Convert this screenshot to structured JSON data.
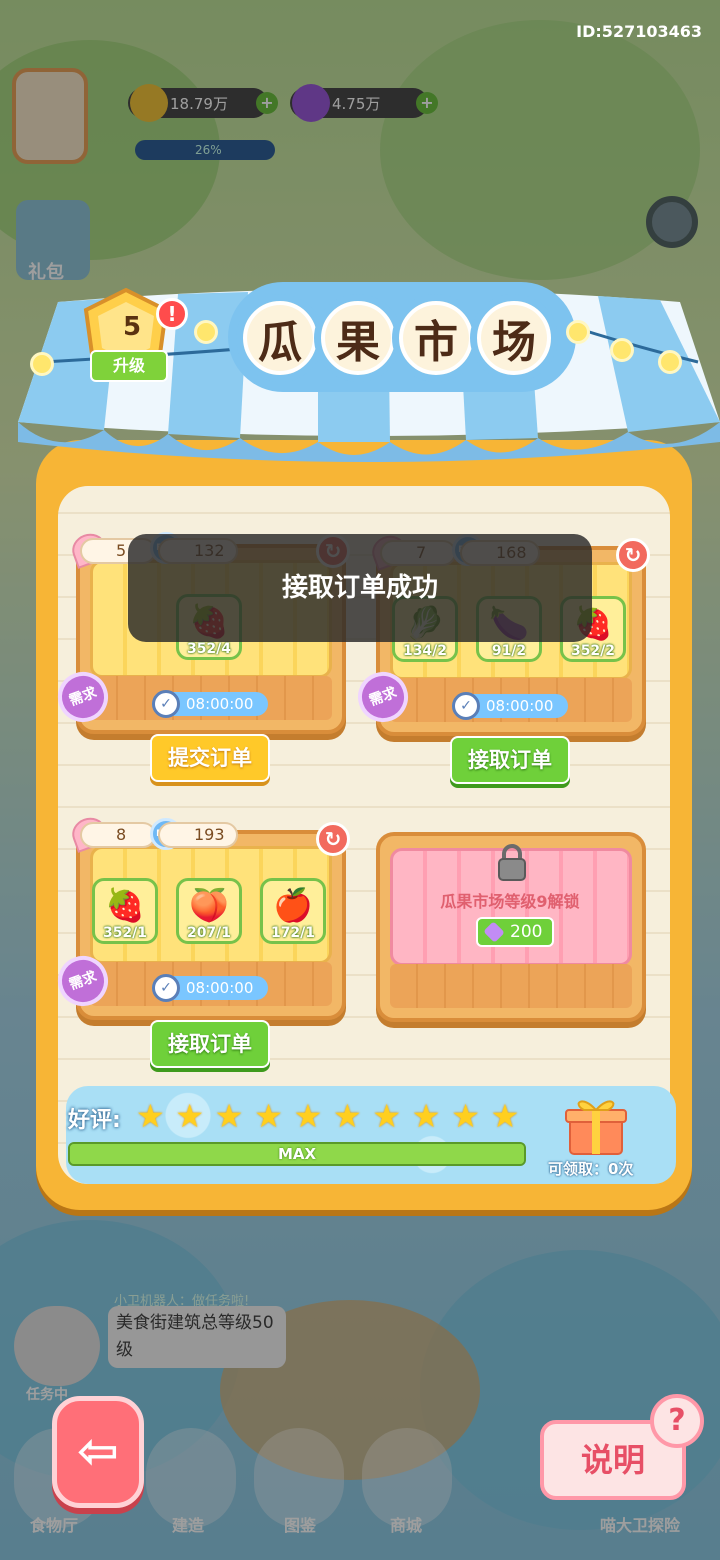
{
  "player_id": "ID:527103463",
  "hud": {
    "coins": "18.79万",
    "gems": "4.75万",
    "progress_text": "26%",
    "side_gift_label": "礼包"
  },
  "market": {
    "title_chars": [
      "瓜",
      "果",
      "市",
      "场"
    ],
    "level": "5",
    "upgrade_label": "升级",
    "alert": "!"
  },
  "orders": [
    {
      "petals": "5",
      "exp": "132",
      "items": [
        {
          "icon": "strawberry",
          "glyph": "🍓",
          "count": "352/4"
        }
      ],
      "timer": "08:00:00",
      "need_label": "需求",
      "button": "提交订单",
      "button_style": "yellow"
    },
    {
      "petals": "7",
      "exp": "168",
      "items": [
        {
          "icon": "radish",
          "glyph": "🥬",
          "count": "134/2"
        },
        {
          "icon": "eggplant",
          "glyph": "🍆",
          "count": "91/2"
        },
        {
          "icon": "strawberry",
          "glyph": "🍓",
          "count": "352/2"
        }
      ],
      "timer": "08:00:00",
      "need_label": "需求",
      "button": "接取订单",
      "button_style": "green"
    },
    {
      "petals": "8",
      "exp": "193",
      "items": [
        {
          "icon": "strawberry",
          "glyph": "🍓",
          "count": "352/1"
        },
        {
          "icon": "peach",
          "glyph": "🍑",
          "count": "207/1"
        },
        {
          "icon": "apple",
          "glyph": "🍎",
          "count": "172/1"
        }
      ],
      "timer": "08:00:00",
      "need_label": "需求",
      "button": "接取订单",
      "button_style": "green"
    }
  ],
  "locked_slot": {
    "label": "瓜果市场等级9解锁",
    "price": "200"
  },
  "rating": {
    "label": "好评:",
    "stars": 10,
    "bar_text": "MAX",
    "progress": 1.0,
    "claim_text": "可领取：0次"
  },
  "toast": "接取订单成功",
  "bottom": {
    "help_label": "说明",
    "help_q": "?",
    "task_head": "小卫机器人：做任务啦!",
    "task_text": "美食街建筑总等级50级",
    "bot_label": "任务中",
    "dock": [
      "食物厅",
      "建造",
      "图鉴",
      "商城"
    ],
    "right_label": "喵大卫探险"
  },
  "colors": {
    "panel_orange": "#f7b536",
    "awning_blue": "#7dc3ef",
    "button_green": "#6fd03a",
    "button_yellow": "#ffc929",
    "star_gold": "#ffcf1f"
  }
}
